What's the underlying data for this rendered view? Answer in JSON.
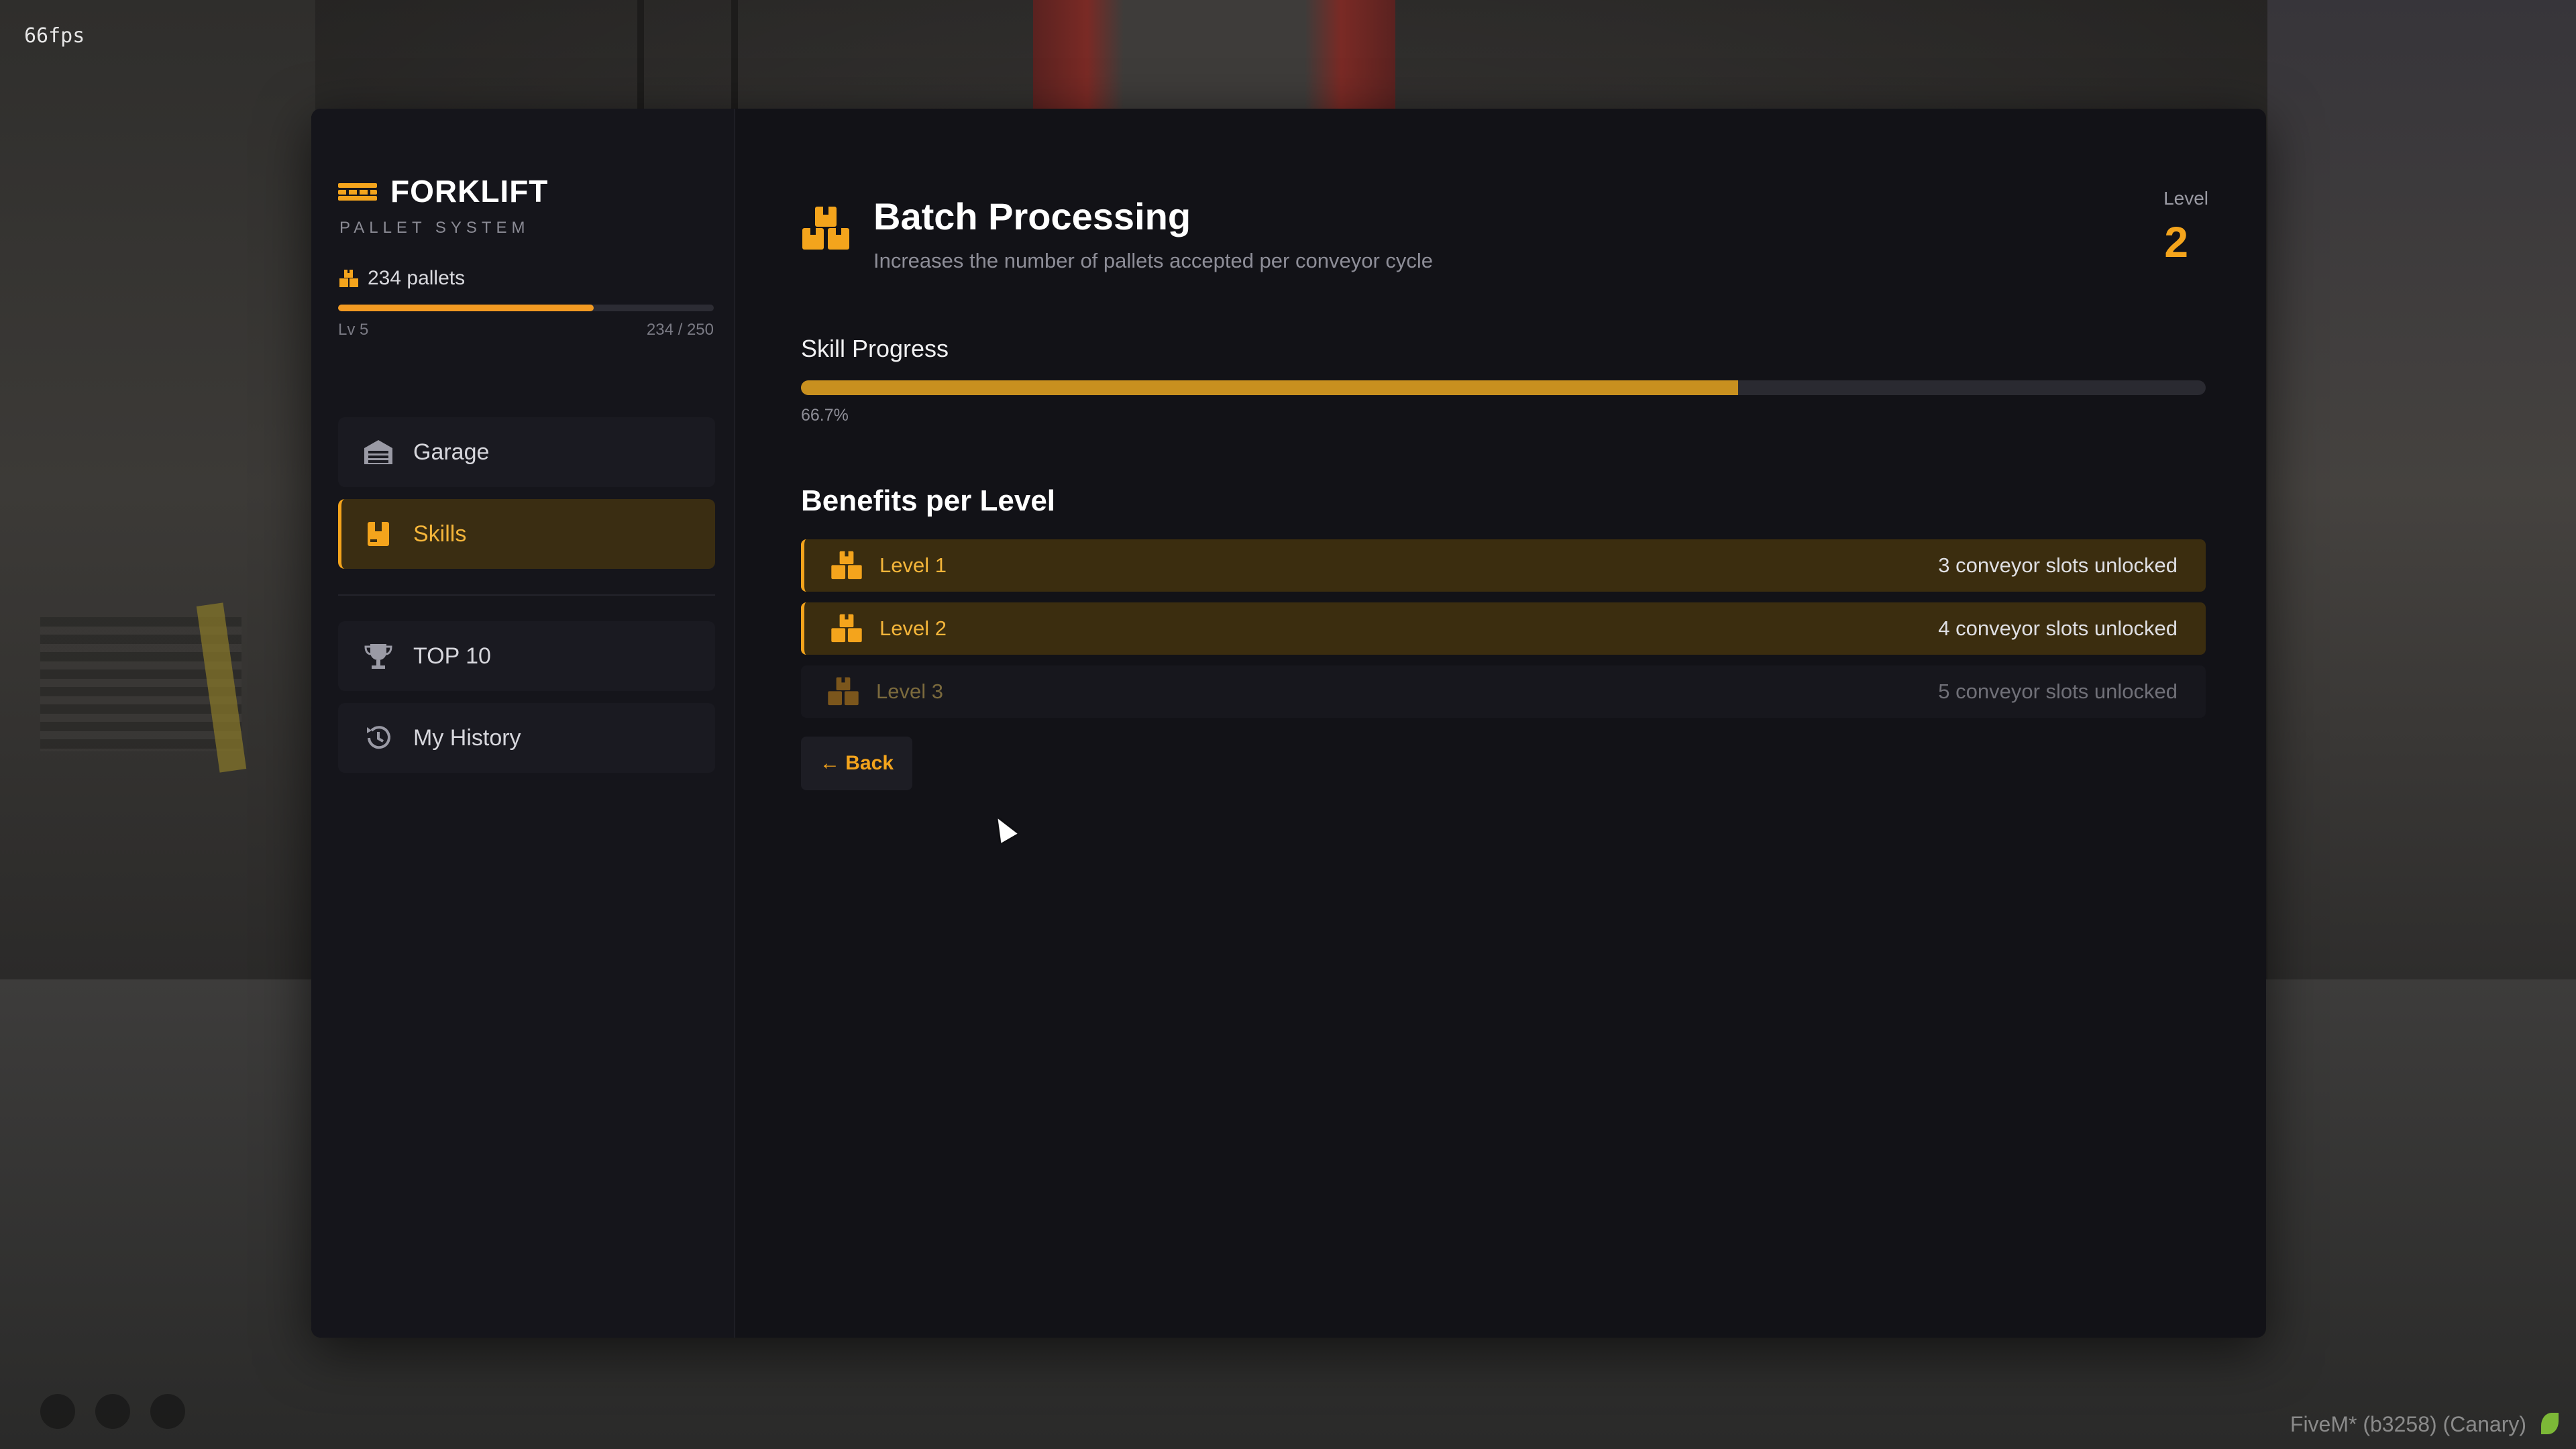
{
  "hud": {
    "fps": "66fps",
    "client_info": "FiveM* (b3258) (Canary)"
  },
  "sidebar": {
    "brand_title": "FORKLIFT",
    "brand_subtitle": "PALLET SYSTEM",
    "pallets_text": "234 pallets",
    "level_text": "Lv 5",
    "xp_text": "234 / 250",
    "xp_fraction": 0.68,
    "nav": [
      {
        "label": "Garage",
        "icon": "garage-icon",
        "active": false
      },
      {
        "label": "Skills",
        "icon": "box-icon",
        "active": true
      },
      {
        "label": "TOP 10",
        "icon": "trophy-icon",
        "active": false
      },
      {
        "label": "My History",
        "icon": "history-icon",
        "active": false
      }
    ]
  },
  "skill": {
    "title": "Batch Processing",
    "description": "Increases the number of pallets accepted per conveyor cycle",
    "level_label": "Level",
    "level_value": "2",
    "progress_label": "Skill Progress",
    "progress_text": "66.7%",
    "progress_fraction": 0.667
  },
  "benefits": {
    "title": "Benefits per Level",
    "rows": [
      {
        "name": "Level 1",
        "value": "3 conveyor slots unlocked",
        "unlocked": true
      },
      {
        "name": "Level 2",
        "value": "4 conveyor slots unlocked",
        "unlocked": true
      },
      {
        "name": "Level 3",
        "value": "5 conveyor slots unlocked",
        "unlocked": false
      }
    ]
  },
  "back_button": {
    "label": "← Back"
  },
  "colors": {
    "accent": "#f4a41c",
    "panel_bg": "#121217",
    "sidebar_bg": "#15151b"
  }
}
